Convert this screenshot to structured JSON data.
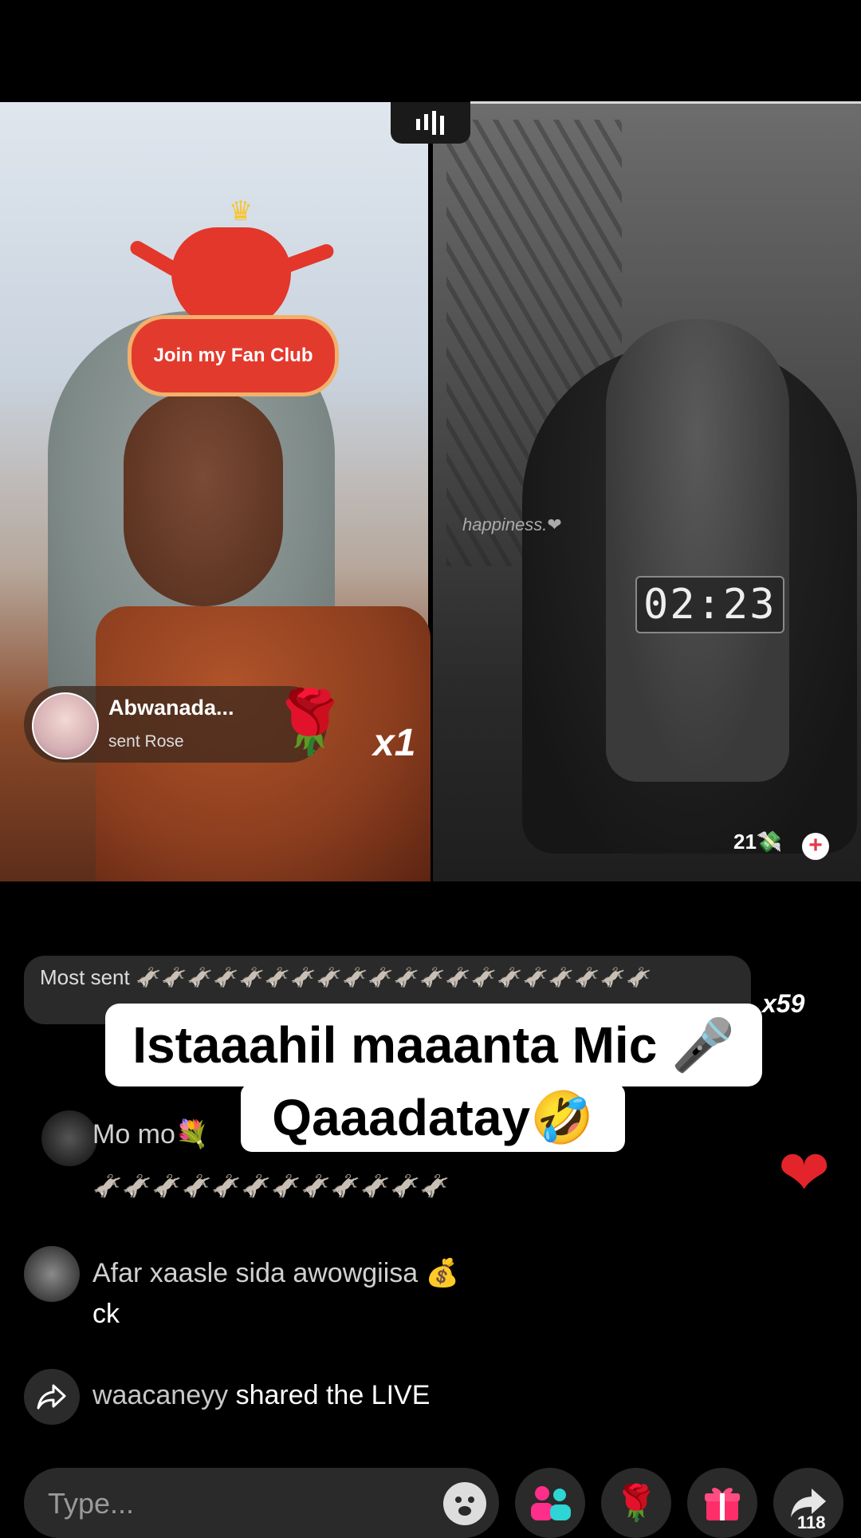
{
  "fan_club": {
    "label": "Join my Fan Club"
  },
  "gift_notification": {
    "sender": "Abwanada...",
    "action": "sent Rose",
    "gift_icon": "🌹",
    "count": "x1"
  },
  "right_stream": {
    "overlay_text": "happiness.❤",
    "timer": "02:23",
    "coins": "21💸"
  },
  "most_sent": {
    "label": "Most sent",
    "icons": "🫏🫏🫏🫏🫏🫏🫏🫏🫏🫏🫏🫏🫏🫏🫏🫏🫏🫏🫏🫏",
    "count": "x59"
  },
  "caption": {
    "line1": "Istaaahil maaanta Mic 🎤",
    "line2": "Qaaadatay🤣"
  },
  "comments": [
    {
      "text": "Mo mo💐",
      "second_line": "🫏🫏🫏🫏🫏🫏🫏🫏🫏🫏🫏🫏"
    },
    {
      "text": "Afar xaasle sida awowgiisa 💰",
      "second_line": "ck"
    }
  ],
  "share_event": {
    "user": "waacaneyy",
    "action": "shared the LIVE"
  },
  "bottom_bar": {
    "placeholder": "Type...",
    "share_count": "118"
  },
  "colors": {
    "accent_red": "#e3242b",
    "fan_club_red": "#e33a2e"
  }
}
